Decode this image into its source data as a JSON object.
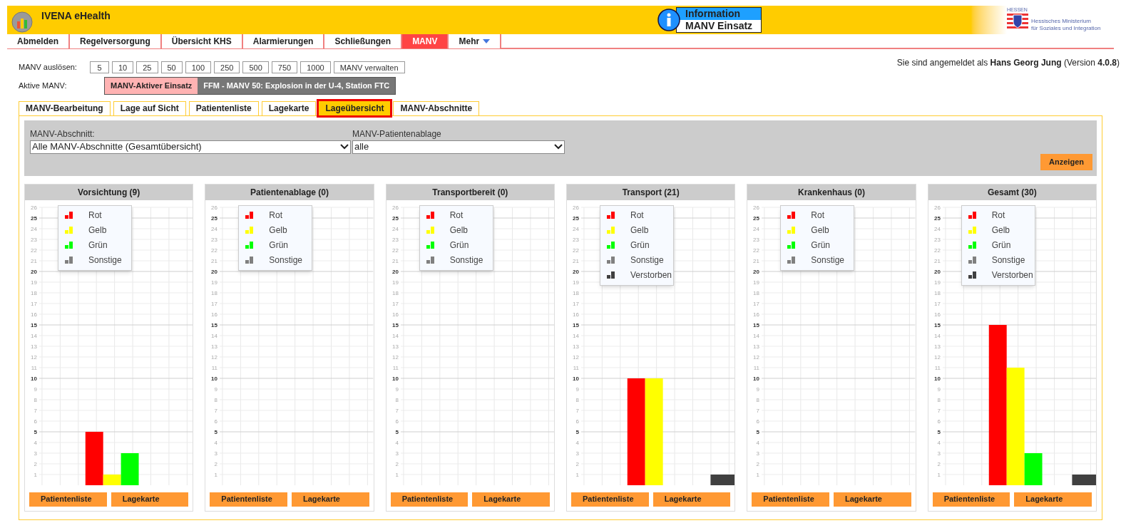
{
  "header": {
    "app_title": "IVENA eHealth",
    "info_title": "Information",
    "info_text": "MANV Einsatz",
    "ministry_state": "HESSEN",
    "ministry_lines": [
      "Hessisches Ministerium",
      "für Soziales und Integration"
    ]
  },
  "nav": [
    {
      "label": "Abmelden",
      "selected": false
    },
    {
      "label": "Regelversorgung",
      "selected": false
    },
    {
      "label": "Übersicht KHS",
      "selected": false
    },
    {
      "label": "Alarmierungen",
      "selected": false
    },
    {
      "label": "Schließungen",
      "selected": false
    },
    {
      "label": "MANV",
      "selected": true
    },
    {
      "label": "Mehr",
      "selected": false,
      "dropdown": true
    }
  ],
  "user_line": "Sie sind angemeldet als **Hans Georg Jung** (Version **4.0.8**)",
  "trigger": {
    "label": "MANV auslösen:",
    "buttons": [
      "5",
      "10",
      "25",
      "50",
      "100",
      "250",
      "500",
      "750",
      "1000",
      "MANV verwalten"
    ]
  },
  "active": {
    "label": "Aktive MANV:",
    "status": "MANV-Aktiver Einsatz",
    "incident": "FFM - MANV 50: Explosion in der U-4, Station FTC"
  },
  "tabs": [
    {
      "label": "MANV-Bearbeitung",
      "selected": false
    },
    {
      "label": "Lage auf Sicht",
      "selected": false
    },
    {
      "label": "Patientenliste",
      "selected": false
    },
    {
      "label": "Lagekarte",
      "selected": false
    },
    {
      "label": "Lageübersicht",
      "selected": true
    },
    {
      "label": "MANV-Abschnitte",
      "selected": false
    }
  ],
  "filter": {
    "section_label": "MANV-Abschnitt:",
    "section_value": "Alle MANV-Abschnitte (Gesamtübersicht)",
    "storage_label": "MANV-Patientenablage",
    "storage_value": "alle",
    "submit": "Anzeigen"
  },
  "charts": [
    {
      "chart_data": {
        "type": "bar",
        "grid": true,
        "title": "Vorsichtung (9)",
        "ylim": [
          0,
          26
        ],
        "yticks": [
          1,
          2,
          3,
          4,
          5,
          6,
          7,
          8,
          9,
          10,
          11,
          12,
          13,
          14,
          15,
          16,
          17,
          18,
          19,
          20,
          21,
          22,
          23,
          24,
          25,
          26
        ],
        "series": [
          {
            "name": "Rot",
            "color": "#ff0000",
            "values": [
              5
            ]
          },
          {
            "name": "Gelb",
            "color": "#ffff00",
            "values": [
              1
            ]
          },
          {
            "name": "Grün",
            "color": "#00ff00",
            "values": [
              3
            ]
          },
          {
            "name": "Sonstige",
            "color": "#808080",
            "values": [
              0
            ]
          }
        ]
      },
      "buttons": [
        "Patientenliste",
        "Lagekarte"
      ]
    },
    {
      "chart_data": {
        "type": "bar",
        "grid": true,
        "title": "Patientenablage (0)",
        "ylim": [
          0,
          26
        ],
        "yticks": [
          1,
          2,
          3,
          4,
          5,
          6,
          7,
          8,
          9,
          10,
          11,
          12,
          13,
          14,
          15,
          16,
          17,
          18,
          19,
          20,
          21,
          22,
          23,
          24,
          25,
          26
        ],
        "series": [
          {
            "name": "Rot",
            "color": "#ff0000",
            "values": [
              0
            ]
          },
          {
            "name": "Gelb",
            "color": "#ffff00",
            "values": [
              0
            ]
          },
          {
            "name": "Grün",
            "color": "#00ff00",
            "values": [
              0
            ]
          },
          {
            "name": "Sonstige",
            "color": "#808080",
            "values": [
              0
            ]
          }
        ]
      },
      "buttons": [
        "Patientenliste",
        "Lagekarte"
      ]
    },
    {
      "chart_data": {
        "type": "bar",
        "grid": true,
        "title": "Transportbereit (0)",
        "ylim": [
          0,
          26
        ],
        "yticks": [
          1,
          2,
          3,
          4,
          5,
          6,
          7,
          8,
          9,
          10,
          11,
          12,
          13,
          14,
          15,
          16,
          17,
          18,
          19,
          20,
          21,
          22,
          23,
          24,
          25,
          26
        ],
        "series": [
          {
            "name": "Rot",
            "color": "#ff0000",
            "values": [
              0
            ]
          },
          {
            "name": "Gelb",
            "color": "#ffff00",
            "values": [
              0
            ]
          },
          {
            "name": "Grün",
            "color": "#00ff00",
            "values": [
              0
            ]
          },
          {
            "name": "Sonstige",
            "color": "#808080",
            "values": [
              0
            ]
          }
        ]
      },
      "buttons": [
        "Patientenliste",
        "Lagekarte"
      ]
    },
    {
      "chart_data": {
        "type": "bar",
        "grid": true,
        "title": "Transport (21)",
        "ylim": [
          0,
          26
        ],
        "yticks": [
          1,
          2,
          3,
          4,
          5,
          6,
          7,
          8,
          9,
          10,
          11,
          12,
          13,
          14,
          15,
          16,
          17,
          18,
          19,
          20,
          21,
          22,
          23,
          24,
          25,
          26
        ],
        "series": [
          {
            "name": "Rot",
            "color": "#ff0000",
            "values": [
              10
            ]
          },
          {
            "name": "Gelb",
            "color": "#ffff00",
            "values": [
              10
            ]
          },
          {
            "name": "Grün",
            "color": "#00ff00",
            "values": [
              0
            ]
          },
          {
            "name": "Sonstige",
            "color": "#808080",
            "values": [
              0
            ]
          },
          {
            "name": "Verstorben",
            "color": "#404040",
            "values": [
              1
            ]
          }
        ]
      },
      "buttons": [
        "Patientenliste",
        "Lagekarte"
      ]
    },
    {
      "chart_data": {
        "type": "bar",
        "grid": true,
        "title": "Krankenhaus (0)",
        "ylim": [
          0,
          26
        ],
        "yticks": [
          1,
          2,
          3,
          4,
          5,
          6,
          7,
          8,
          9,
          10,
          11,
          12,
          13,
          14,
          15,
          16,
          17,
          18,
          19,
          20,
          21,
          22,
          23,
          24,
          25,
          26
        ],
        "series": [
          {
            "name": "Rot",
            "color": "#ff0000",
            "values": [
              0
            ]
          },
          {
            "name": "Gelb",
            "color": "#ffff00",
            "values": [
              0
            ]
          },
          {
            "name": "Grün",
            "color": "#00ff00",
            "values": [
              0
            ]
          },
          {
            "name": "Sonstige",
            "color": "#808080",
            "values": [
              0
            ]
          }
        ]
      },
      "buttons": [
        "Patientenliste",
        "Lagekarte"
      ]
    },
    {
      "chart_data": {
        "type": "bar",
        "grid": true,
        "title": "Gesamt (30)",
        "ylim": [
          0,
          26
        ],
        "yticks": [
          1,
          2,
          3,
          4,
          5,
          6,
          7,
          8,
          9,
          10,
          11,
          12,
          13,
          14,
          15,
          16,
          17,
          18,
          19,
          20,
          21,
          22,
          23,
          24,
          25,
          26
        ],
        "series": [
          {
            "name": "Rot",
            "color": "#ff0000",
            "values": [
              15
            ]
          },
          {
            "name": "Gelb",
            "color": "#ffff00",
            "values": [
              11
            ]
          },
          {
            "name": "Grün",
            "color": "#00ff00",
            "values": [
              3
            ]
          },
          {
            "name": "Sonstige",
            "color": "#808080",
            "values": [
              0
            ]
          },
          {
            "name": "Verstorben",
            "color": "#404040",
            "values": [
              1
            ]
          }
        ]
      },
      "buttons": [
        "Patientenliste",
        "Lagekarte"
      ]
    }
  ]
}
